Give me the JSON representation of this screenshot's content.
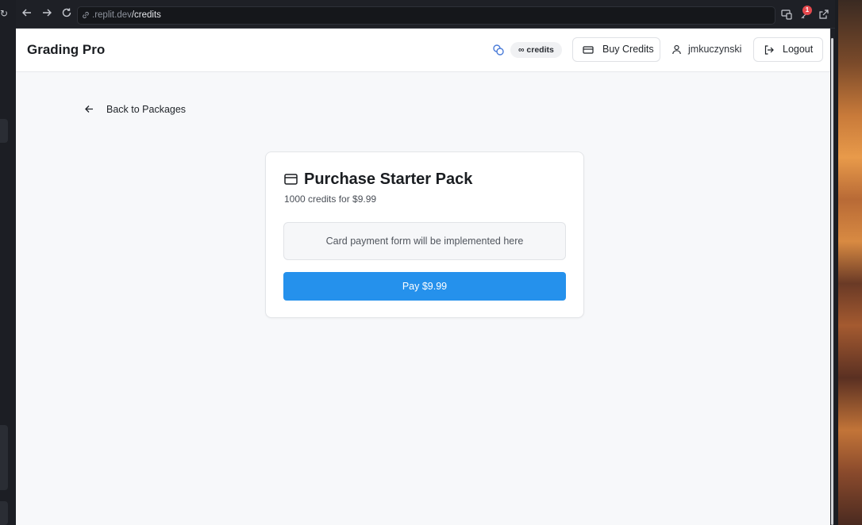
{
  "browser": {
    "url_prefix": ".replit.dev",
    "url_path": "/credits",
    "notification_count": "1"
  },
  "header": {
    "brand": "Grading Pro",
    "credits_label": "∞ credits",
    "buy_credits_label": "Buy Credits",
    "username": "jmkuczynski",
    "logout_label": "Logout"
  },
  "nav": {
    "back_label": "Back to Packages"
  },
  "purchase": {
    "title": "Purchase Starter Pack",
    "subtitle": "1000 credits for $9.99",
    "placeholder_text": "Card payment form will be implemented here",
    "pay_label": "Pay $9.99"
  },
  "colors": {
    "accent": "#2591ec",
    "credits_icon": "#4a7bd8",
    "badge": "#e5484d"
  },
  "icons": {
    "credits": "coins-icon",
    "buy_credits": "credit-card-icon",
    "user": "user-icon",
    "logout": "logout-icon",
    "back": "arrow-left-icon",
    "card_title": "credit-card-icon"
  }
}
